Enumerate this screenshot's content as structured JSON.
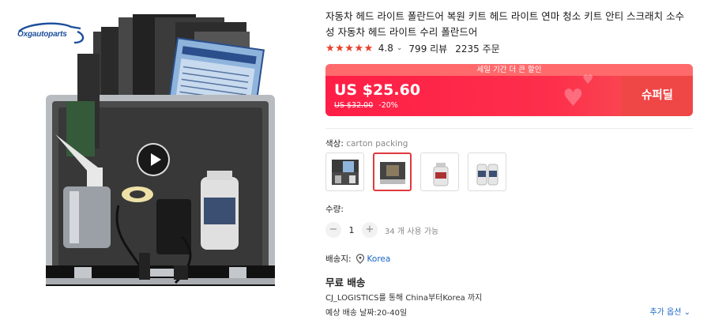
{
  "image": {
    "brand_logo_text": "Oxgautoparts",
    "play_icon": "play-icon"
  },
  "product": {
    "title": "자동차 헤드 라이트 폴란드어 복원 키트 헤드 라이트 연마 청소 키트 안티 스크래치 소수성 자동차 헤드 라이트 수리 폴란드어",
    "stars": "★★★★★",
    "rating": "4.8",
    "rating_chevron": "⌄",
    "reviews": "799 리뷰",
    "orders": "2235 주문"
  },
  "deal": {
    "banner_label": "세일 기간 더 큰 할인",
    "price": "US $25.60",
    "old_price": "US $32.00",
    "discount": "-20%",
    "superdeal_label": "슈퍼딜",
    "accent_color": "#ff1e46"
  },
  "variant": {
    "label": "색상:",
    "selected_name": "carton packing",
    "selected_index": 1,
    "count": 4
  },
  "quantity": {
    "label": "수량:",
    "minus": "−",
    "plus": "+",
    "value": "1",
    "available": "34 개 사용 가능"
  },
  "shipping": {
    "ship_to_label": "배송지:",
    "pin_icon": "map-pin-icon",
    "country": "Korea",
    "free_shipping": "무료 배송",
    "logistics": "CJ_LOGISTICS를 통해 China부터Korea 까지",
    "eta": "예상 배송 날짜:20-40일",
    "more_options": "추가 옵션",
    "more_chevron": "⌄"
  }
}
